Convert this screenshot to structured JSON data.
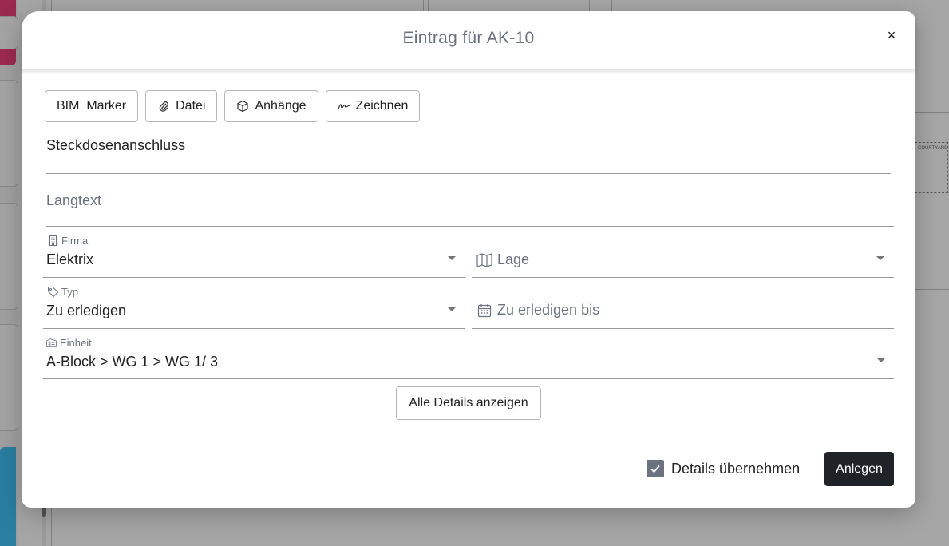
{
  "dialog": {
    "title": "Eintrag für AK-10",
    "close_icon": "×"
  },
  "toolbar": {
    "bim_marker": "BIM  Marker",
    "datei": "Datei",
    "anhaenge": "Anhänge",
    "zeichnen": "Zeichnen"
  },
  "form": {
    "title_value": "Steckdosenanschluss",
    "langtext_placeholder": "Langtext",
    "firma": {
      "label": "Firma",
      "value": "Elektrix"
    },
    "lage": {
      "placeholder": "Lage"
    },
    "typ": {
      "label": "Typ",
      "value": "Zu erledigen"
    },
    "due": {
      "placeholder": "Zu erledigen bis"
    },
    "einheit": {
      "label": "Einheit",
      "value": "A-Block > WG 1 > WG 1/ 3"
    }
  },
  "actions": {
    "show_details": "Alle Details anzeigen",
    "take_over_details": "Details übernehmen",
    "take_over_checked": true,
    "create": "Anlegen"
  },
  "background": {
    "plan_label": "COURTYARD"
  },
  "colors": {
    "primary_button": "#1f2328",
    "checkbox": "#6b7280",
    "accent_pink": "#9c2a50",
    "accent_blue": "#2a7ea0"
  }
}
